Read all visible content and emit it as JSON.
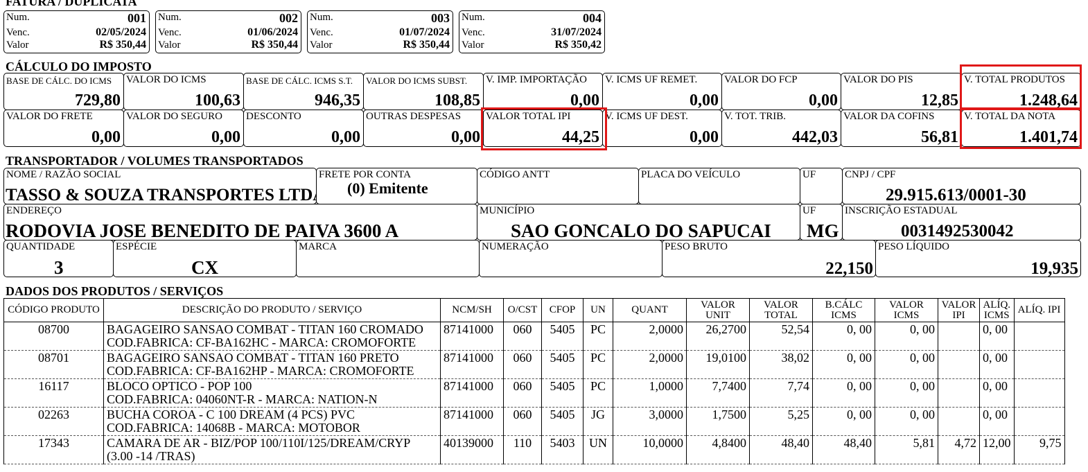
{
  "fatura": {
    "title": "FATURA / DUPLICATA",
    "labels": {
      "num": "Num.",
      "venc": "Venc.",
      "valor": "Valor"
    },
    "items": [
      {
        "num": "001",
        "venc": "02/05/2024",
        "valor": "R$ 350,44"
      },
      {
        "num": "002",
        "venc": "01/06/2024",
        "valor": "R$ 350,44"
      },
      {
        "num": "003",
        "venc": "01/07/2024",
        "valor": "R$ 350,44"
      },
      {
        "num": "004",
        "venc": "31/07/2024",
        "valor": "R$ 350,42"
      }
    ]
  },
  "imposto": {
    "title": "CÁLCULO DO IMPOSTO",
    "row1": [
      {
        "label": "BASE DE CÁLC. DO ICMS",
        "value": "729,80"
      },
      {
        "label": "VALOR DO ICMS",
        "value": "100,63"
      },
      {
        "label": "BASE DE CÁLC. ICMS S.T.",
        "value": "946,35"
      },
      {
        "label": "VALOR DO ICMS SUBST.",
        "value": "108,85"
      },
      {
        "label": "V. IMP. IMPORTAÇÃO",
        "value": "0,00"
      },
      {
        "label": "V. ICMS UF REMET.",
        "value": "0,00"
      },
      {
        "label": "VALOR DO FCP",
        "value": "0,00"
      },
      {
        "label": "VALOR DO PIS",
        "value": "12,85"
      },
      {
        "label": "V. TOTAL PRODUTOS",
        "value": "1.248,64"
      }
    ],
    "row2": [
      {
        "label": "VALOR DO FRETE",
        "value": "0,00"
      },
      {
        "label": "VALOR DO SEGURO",
        "value": "0,00"
      },
      {
        "label": "DESCONTO",
        "value": "0,00"
      },
      {
        "label": "OUTRAS DESPESAS",
        "value": "0,00"
      },
      {
        "label": "VALOR TOTAL IPI",
        "value": "44,25"
      },
      {
        "label": "V. ICMS UF DEST.",
        "value": "0,00"
      },
      {
        "label": "V. TOT. TRIB.",
        "value": "442,03"
      },
      {
        "label": "VALOR DA COFINS",
        "value": "56,81"
      },
      {
        "label": "V. TOTAL DA NOTA",
        "value": "1.401,74"
      }
    ]
  },
  "transp": {
    "title": "TRANSPORTADOR / VOLUMES TRANSPORTADOS",
    "nome_label": "NOME / RAZÃO SOCIAL",
    "nome": "TASSO & SOUZA TRANSPORTES LTDA",
    "frete_label": "FRETE POR CONTA",
    "frete": "(0) Emitente",
    "antt_label": "CÓDIGO ANTT",
    "placa_label": "PLACA DO VEÍCULO",
    "uf_label": "UF",
    "cnpj_label": "CNPJ / CPF",
    "cnpj": "29.915.613/0001-30",
    "end_label": "ENDEREÇO",
    "endereco": "RODOVIA JOSE BENEDITO DE PAIVA 3600 A",
    "mun_label": "MUNICÍPIO",
    "municipio": "SAO GONCALO DO SAPUCAI",
    "uf2_label": "UF",
    "uf": "MG",
    "ie_label": "INSCRIÇÃO ESTADUAL",
    "ie": "0031492530042",
    "qtd_label": "QUANTIDADE",
    "qtd": "3",
    "esp_label": "ESPÉCIE",
    "especie": "CX",
    "marca_label": "MARCA",
    "num_label": "NUMERAÇÃO",
    "pb_label": "PESO BRUTO",
    "peso_bruto": "22,150",
    "pl_label": "PESO LÍQUIDO",
    "peso_liquido": "19,935"
  },
  "produtos": {
    "title": "DADOS DOS PRODUTOS / SERVIÇOS",
    "headers": {
      "codigo": "CÓDIGO PRODUTO",
      "descricao": "DESCRIÇÃO DO PRODUTO / SERVIÇO",
      "ncm": "NCM/SH",
      "ocst": "O/CST",
      "cfop": "CFOP",
      "un": "UN",
      "quant": "QUANT",
      "vunit_1": "VALOR",
      "vunit_2": "UNIT",
      "vtotal_1": "VALOR",
      "vtotal_2": "TOTAL",
      "bcalc_1": "B.CÁLC",
      "bcalc_2": "ICMS",
      "vicms_1": "VALOR",
      "vicms_2": "ICMS",
      "vipi_1": "VALOR",
      "vipi_2": "IPI",
      "aliqicms_1": "ALÍQ.",
      "aliqicms_2": "ICMS",
      "aliqipi": "ALÍQ. IPI"
    },
    "rows": [
      {
        "codigo": "08700",
        "desc1": "BAGAGEIRO SANSAO COMBAT - TITAN 160 CROMADO",
        "desc2": "COD.FABRICA: CF-BA162HC - MARCA: CROMOFORTE",
        "ncm": "87141000",
        "ocst": "060",
        "cfop": "5405",
        "un": "PC",
        "quant": "2,0000",
        "vunit": "26,2700",
        "vtotal": "52,54",
        "bcalc": "0, 00",
        "vicms": "0, 00",
        "vipi": "",
        "aliqicms": "0, 00",
        "aliqipi": ""
      },
      {
        "codigo": "08701",
        "desc1": "BAGAGEIRO SANSAO COMBAT - TITAN 160 PRETO",
        "desc2": "COD.FABRICA: CF-BA162HP - MARCA: CROMOFORTE",
        "ncm": "87141000",
        "ocst": "060",
        "cfop": "5405",
        "un": "PC",
        "quant": "2,0000",
        "vunit": "19,0100",
        "vtotal": "38,02",
        "bcalc": "0, 00",
        "vicms": "0, 00",
        "vipi": "",
        "aliqicms": "0, 00",
        "aliqipi": ""
      },
      {
        "codigo": "16117",
        "desc1": "BLOCO OPTICO - POP 100",
        "desc2": "COD.FABRICA: 04060NT-R - MARCA: NATION-N",
        "ncm": "87141000",
        "ocst": "060",
        "cfop": "5405",
        "un": "PC",
        "quant": "1,0000",
        "vunit": "7,7400",
        "vtotal": "7,74",
        "bcalc": "0, 00",
        "vicms": "0, 00",
        "vipi": "",
        "aliqicms": "0, 00",
        "aliqipi": ""
      },
      {
        "codigo": "02263",
        "desc1": "BUCHA COROA - C 100 DREAM (4 PCS) PVC",
        "desc2": "COD.FABRICA: 14068B - MARCA: MOTOBOR",
        "ncm": "87141000",
        "ocst": "060",
        "cfop": "5405",
        "un": "JG",
        "quant": "3,0000",
        "vunit": "1,7500",
        "vtotal": "5,25",
        "bcalc": "0, 00",
        "vicms": "0, 00",
        "vipi": "",
        "aliqicms": "0, 00",
        "aliqipi": ""
      },
      {
        "codigo": "17343",
        "desc1": "CAMARA DE AR - BIZ/POP 100/110I/125/DREAM/CRYP",
        "desc2": "(3.00 -14 /TRAS)",
        "ncm": "40139000",
        "ocst": "110",
        "cfop": "5403",
        "un": "UN",
        "quant": "10,0000",
        "vunit": "4,8400",
        "vtotal": "48,40",
        "bcalc": "48,40",
        "vicms": "5,81",
        "vipi": "4,72",
        "aliqicms": "12,00",
        "aliqipi": "9,75"
      }
    ]
  }
}
